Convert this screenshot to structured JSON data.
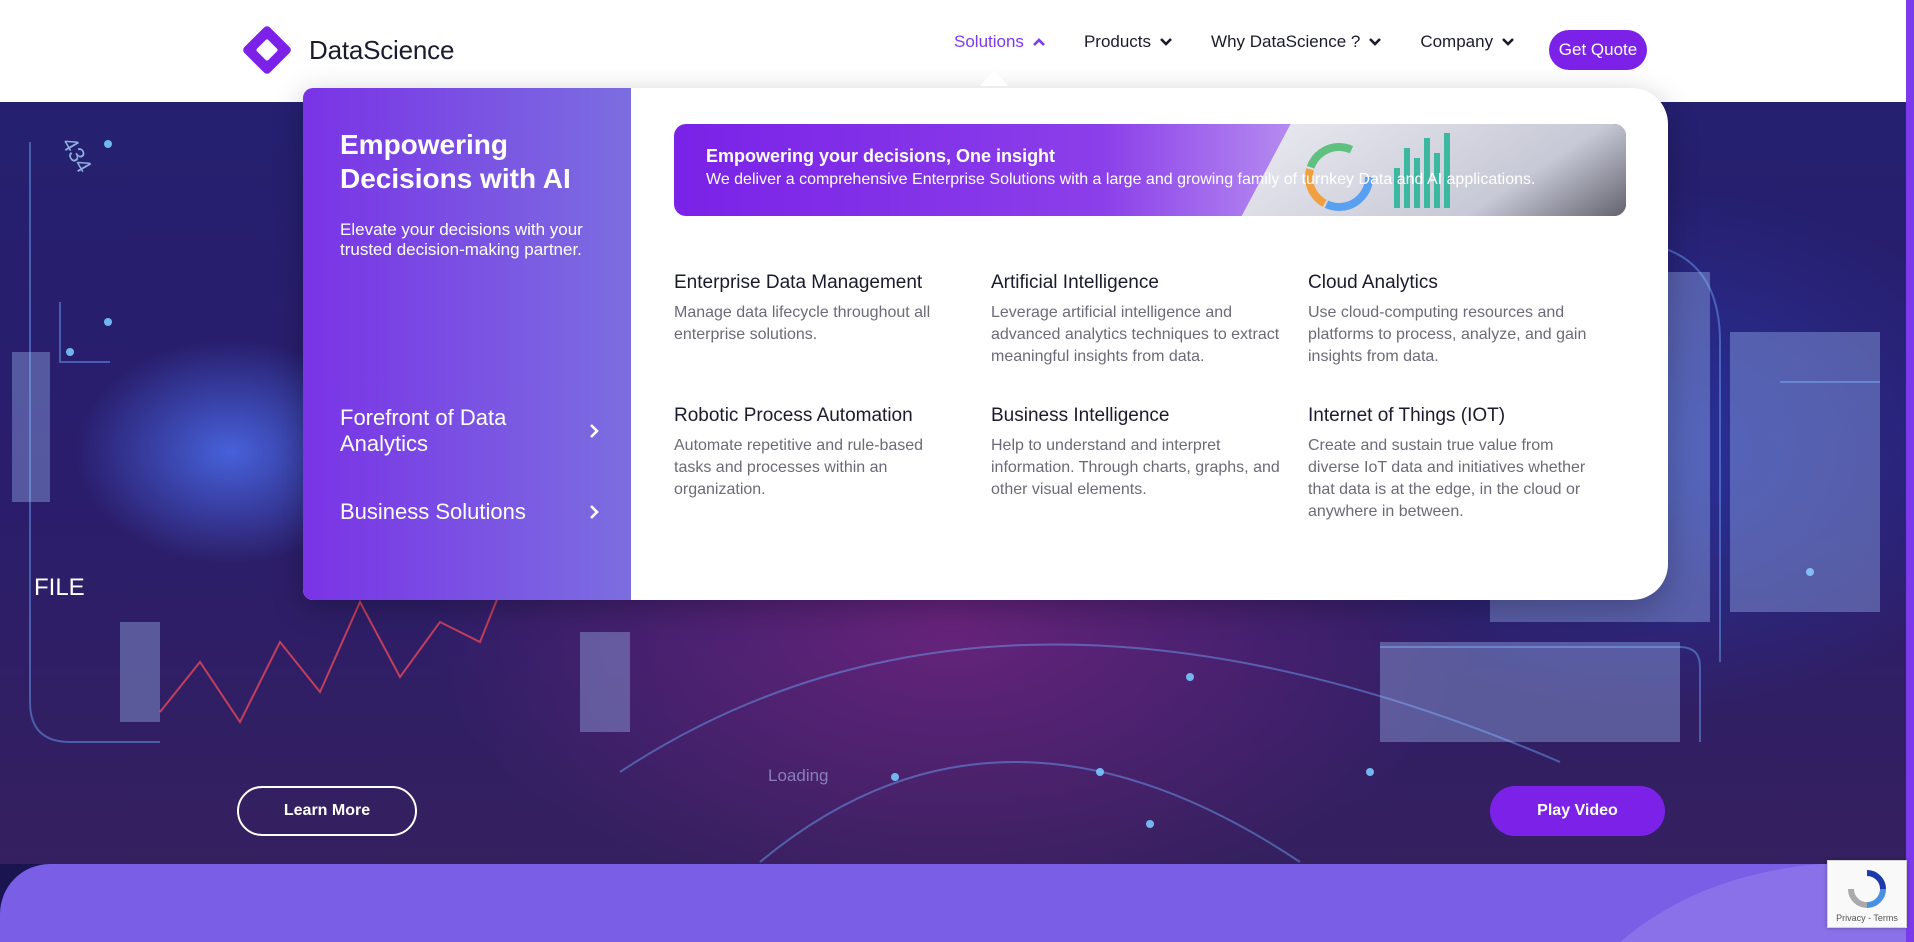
{
  "header": {
    "logo_text": "DataScience",
    "nav": [
      {
        "label": "Solutions",
        "active": true,
        "icon": "chevron-up-icon"
      },
      {
        "label": "Products",
        "active": false,
        "icon": "chevron-down-icon"
      },
      {
        "label": "Why DataScience ?",
        "active": false,
        "icon": "chevron-down-icon"
      },
      {
        "label": "Company",
        "active": false,
        "icon": "chevron-down-icon"
      }
    ],
    "cta_label": "Get Quote"
  },
  "mega_menu": {
    "side": {
      "title": "Empowering Decisions with AI",
      "description": "Elevate your decisions with your trusted decision-making partner.",
      "links": [
        {
          "label": "Forefront of Data Analytics",
          "icon": "chevron-right-icon"
        },
        {
          "label": "Business Solutions",
          "icon": "chevron-right-icon"
        }
      ]
    },
    "banner": {
      "title": "Empowering your decisions, One insight",
      "description": "We deliver a comprehensive Enterprise Solutions with a large and growing family of turnkey Data and AI applications."
    },
    "items": [
      {
        "title": "Enterprise Data Management",
        "description": "Manage data lifecycle throughout all enterprise solutions."
      },
      {
        "title": "Artificial Intelligence",
        "description": "Leverage artificial intelligence and advanced analytics techniques to extract meaningful insights from data."
      },
      {
        "title": "Cloud Analytics",
        "description": "Use cloud-computing resources and platforms to process, analyze, and gain insights from data."
      },
      {
        "title": "Robotic Process Automation",
        "description": "Automate repetitive and rule-based tasks and processes within an organization."
      },
      {
        "title": "Business Intelligence",
        "description": "Help to understand and interpret information. Through charts, graphs, and other visual elements."
      },
      {
        "title": "Internet of Things (IOT)",
        "description": "Create and sustain true value from diverse IoT data and initiatives whether that data is at the edge, in the cloud or anywhere in between."
      }
    ]
  },
  "hero": {
    "learn_more_label": "Learn More",
    "play_video_label": "Play Video",
    "loading_text": "Loading",
    "hud_text": {
      "file": "FILE",
      "num": "434"
    }
  },
  "recaptcha": {
    "text": "Privacy - Terms"
  },
  "colors": {
    "accent": "#7c22e8",
    "band": "#7a5ee6"
  }
}
